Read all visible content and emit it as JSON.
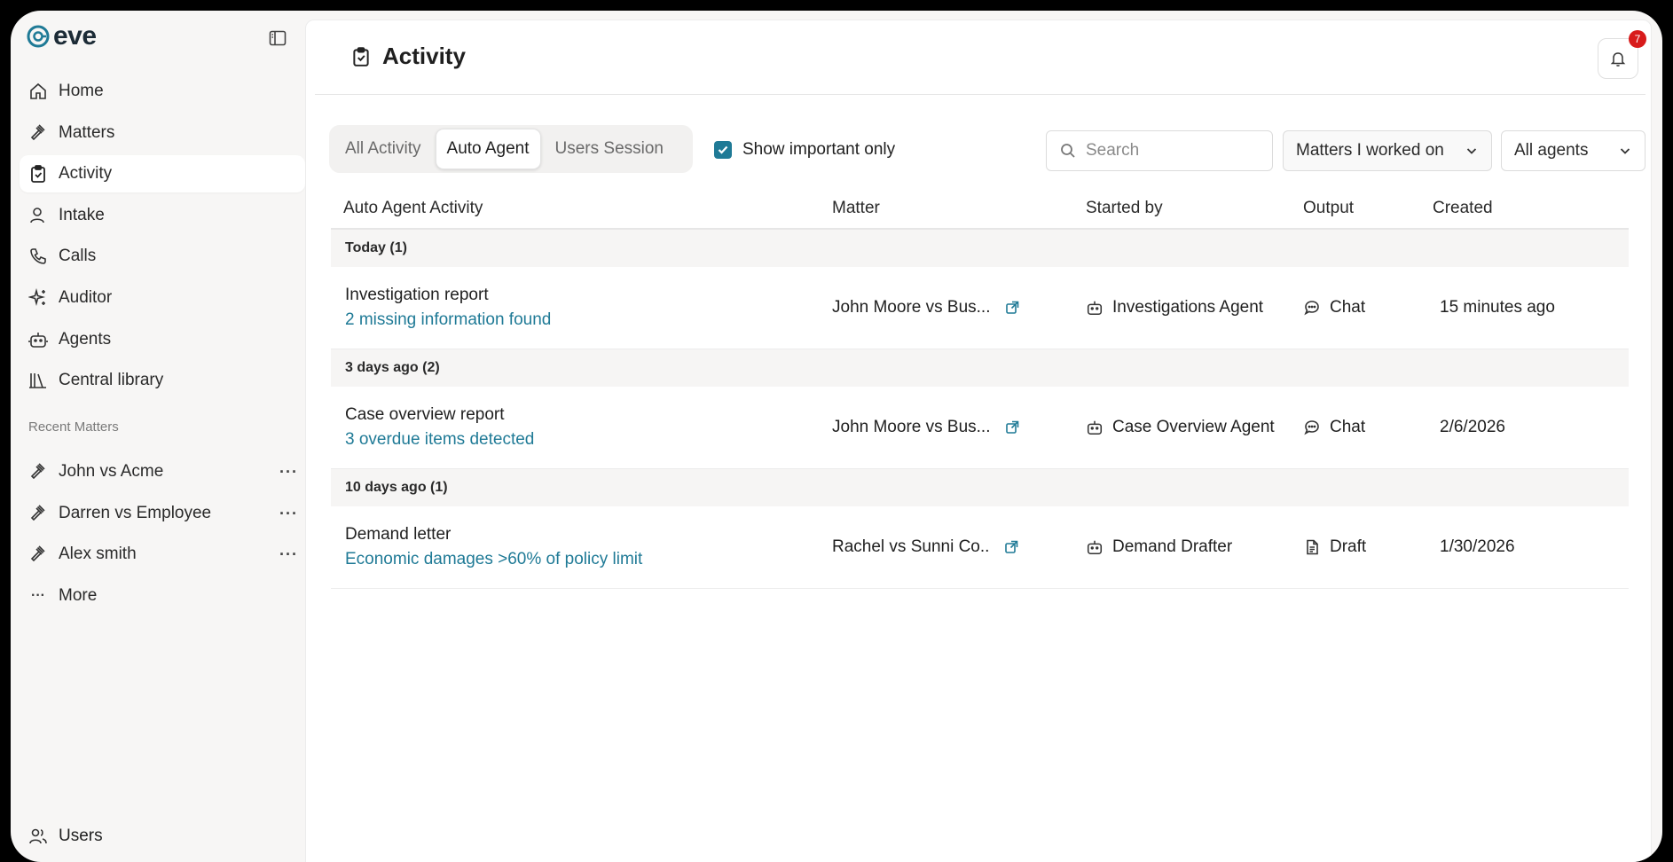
{
  "app": {
    "name": "eve"
  },
  "sidebar": {
    "nav": [
      {
        "label": "Home",
        "icon": "home-icon"
      },
      {
        "label": "Matters",
        "icon": "gavel-icon"
      },
      {
        "label": "Activity",
        "icon": "clipboard-check-icon",
        "active": true
      },
      {
        "label": "Intake",
        "icon": "user-icon"
      },
      {
        "label": "Calls",
        "icon": "phone-icon"
      },
      {
        "label": "Auditor",
        "icon": "sparkles-icon"
      },
      {
        "label": "Agents",
        "icon": "robot-icon"
      },
      {
        "label": "Central library",
        "icon": "library-icon"
      }
    ],
    "recent_title": "Recent Matters",
    "recent": [
      {
        "label": "John vs Acme"
      },
      {
        "label": "Darren vs Employee"
      },
      {
        "label": "Alex smith"
      }
    ],
    "more_label": "More",
    "users_label": "Users"
  },
  "header": {
    "title": "Activity",
    "notification_count": "7"
  },
  "tabs": [
    {
      "label": "All Activity",
      "active": false
    },
    {
      "label": "Auto Agent",
      "active": true
    },
    {
      "label": "Users Session",
      "active": false
    }
  ],
  "filters": {
    "important_label": "Show important only",
    "important_checked": true,
    "search_placeholder": "Search",
    "matters_select": "Matters I worked on",
    "agents_select": "All agents"
  },
  "table": {
    "headers": {
      "activity": "Auto Agent Activity",
      "matter": "Matter",
      "started_by": "Started by",
      "output": "Output",
      "created": "Created"
    },
    "groups": [
      {
        "label": "Today (1)",
        "rows": [
          {
            "title": "Investigation report",
            "subtitle": "2 missing information found",
            "matter": "John Moore vs Bus...",
            "agent": "Investigations Agent",
            "output": "Chat",
            "output_icon": "chat-icon",
            "created": "15 minutes ago"
          }
        ]
      },
      {
        "label": "3 days ago (2)",
        "rows": [
          {
            "title": "Case overview report",
            "subtitle": "3 overdue items detected",
            "matter": "John Moore vs Bus...",
            "agent": "Case Overview Agent",
            "output": "Chat",
            "output_icon": "chat-icon",
            "created": "2/6/2026"
          }
        ]
      },
      {
        "label": "10 days ago (1)",
        "rows": [
          {
            "title": "Demand letter",
            "subtitle": "Economic damages >60% of policy limit",
            "matter": "Rachel vs Sunni Co..",
            "agent": "Demand Drafter",
            "output": "Draft",
            "output_icon": "document-icon",
            "created": "1/30/2026"
          }
        ]
      }
    ]
  },
  "colors": {
    "accent": "#1f7a96",
    "badge": "#d81b1b",
    "sidebar_bg": "#f7f6f5"
  }
}
